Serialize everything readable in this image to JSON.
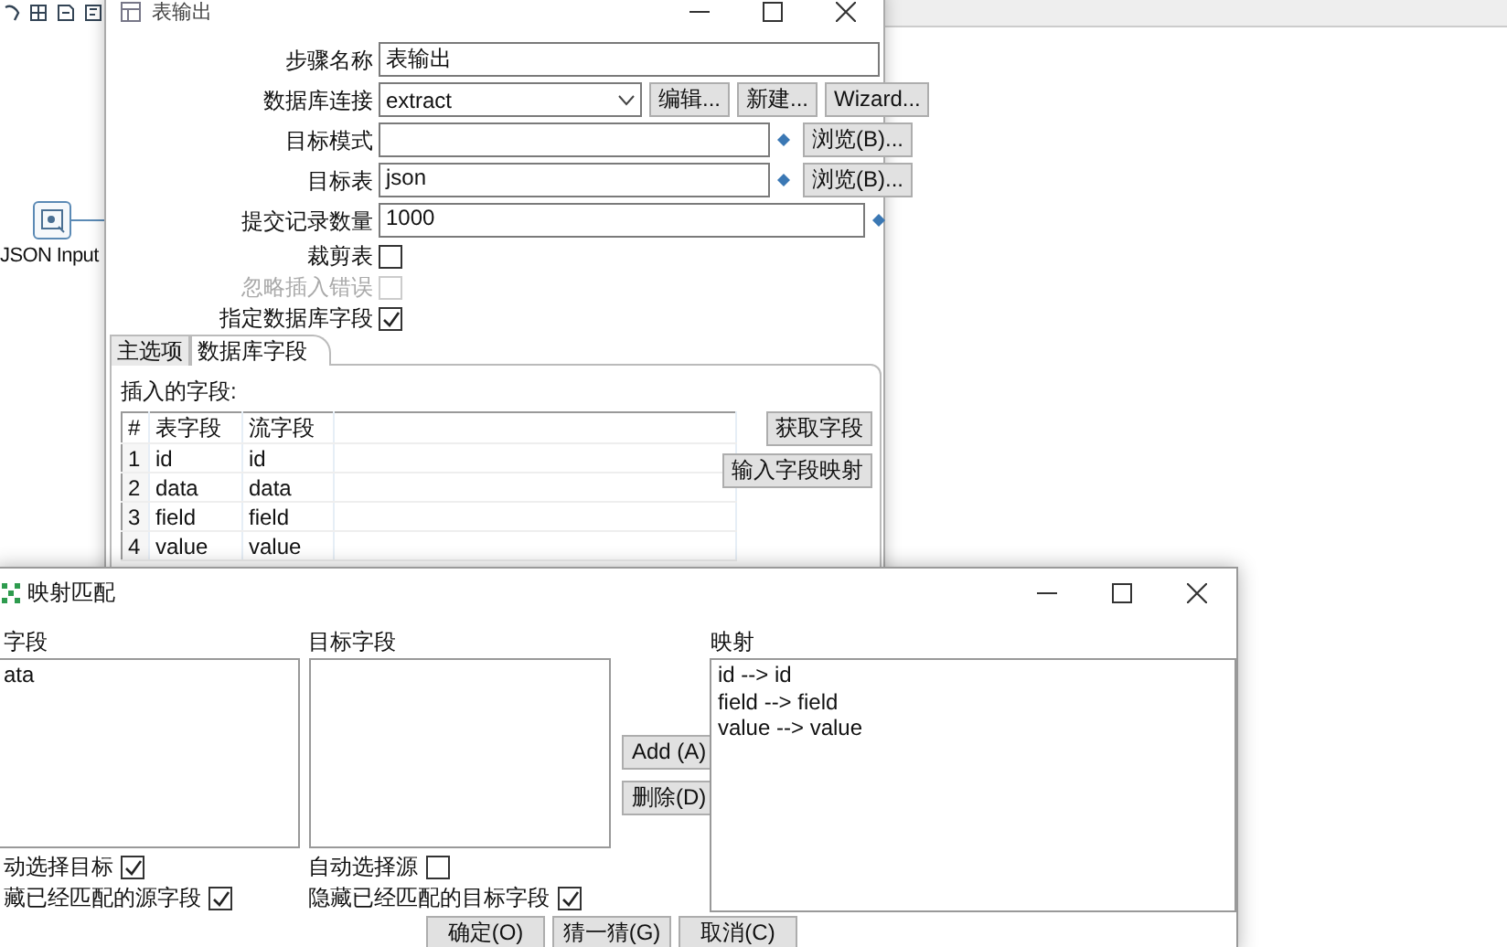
{
  "canvas": {
    "node": {
      "label": "JSON Input"
    }
  },
  "table_output_dialog": {
    "title": "表输出",
    "fields": [
      {
        "kind": "text",
        "label": "步骤名称",
        "value": "表输出"
      },
      {
        "kind": "select",
        "label": "数据库连接",
        "value": "extract",
        "buttons": [
          "编辑...",
          "新建...",
          "Wizard..."
        ]
      },
      {
        "kind": "text",
        "label": "目标模式",
        "variable": true,
        "buttons": [
          "浏览(B)..."
        ]
      },
      {
        "kind": "text",
        "label": "目标表",
        "value": "json",
        "variable": true,
        "buttons": [
          "浏览(B)..."
        ]
      },
      {
        "kind": "text",
        "label": "提交记录数量",
        "value": "1000",
        "variable": true
      },
      {
        "kind": "checkbox",
        "label": "裁剪表",
        "checked": false,
        "disabled": false
      },
      {
        "kind": "checkbox",
        "label": "忽略插入错误",
        "checked": false,
        "disabled": true
      },
      {
        "kind": "checkbox",
        "label": "指定数据库字段",
        "checked": true,
        "disabled": false
      }
    ],
    "tabs": [
      {
        "label": "主选项",
        "selected": false
      },
      {
        "label": "数据库字段",
        "selected": true
      }
    ],
    "fields_label": "插入的字段:",
    "table": {
      "columns": [
        "#",
        "表字段",
        "流字段"
      ],
      "rows": [
        [
          "1",
          "id",
          "id"
        ],
        [
          "2",
          "data",
          "data"
        ],
        [
          "3",
          "field",
          "field"
        ],
        [
          "4",
          "value",
          "value"
        ]
      ]
    },
    "side_buttons": [
      "获取字段",
      "输入字段映射"
    ]
  },
  "mapping_dialog": {
    "title": "映射匹配",
    "source": {
      "label": "字段",
      "items": [
        "ata"
      ]
    },
    "target": {
      "label": "目标字段"
    },
    "middle_buttons": [
      "Add (A)",
      "删除(D)"
    ],
    "mapping": {
      "label": "映射",
      "items": [
        "id --> id",
        "field --> field",
        "value --> value"
      ]
    },
    "source_options": [
      {
        "label": "动选择目标",
        "checked": true
      },
      {
        "label": "藏已经匹配的源字段",
        "checked": true
      }
    ],
    "target_options": [
      {
        "label": "自动选择源",
        "checked": false
      },
      {
        "label": "隐藏已经匹配的目标字段",
        "checked": true
      }
    ],
    "buttons": [
      "确定(O)",
      "猜一猜(G)",
      "取消(C)"
    ]
  }
}
